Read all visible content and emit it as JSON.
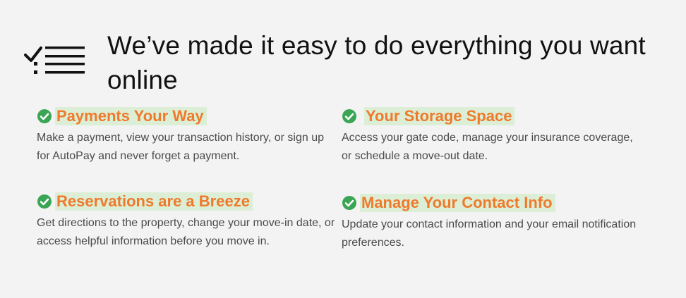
{
  "header": {
    "icon": "checklist-icon",
    "headline": "We’ve made it easy to do everything you want online"
  },
  "colors": {
    "background": "#f3f3f3",
    "title_orange": "#ef7a2c",
    "title_highlight": "#dcefd6",
    "check_green": "#3aa655",
    "body_text": "#4a4a4a"
  },
  "features": [
    {
      "icon": "check-circle-icon",
      "title": "Payments Your Way",
      "description": "Make a payment, view your transaction history, or sign up for AutoPay and never forget a payment."
    },
    {
      "icon": "check-circle-icon",
      "title": "Your Storage Space",
      "description": "Access your gate code, manage your insurance coverage, or schedule a move-out date."
    },
    {
      "icon": "check-circle-icon",
      "title": "Reservations are a Breeze",
      "description": "Get directions to the property, change your move-in date, or access helpful information before you move in."
    },
    {
      "icon": "check-circle-icon",
      "title": "Manage Your Contact Info",
      "description": "Update your contact information and your email notification preferences."
    }
  ]
}
